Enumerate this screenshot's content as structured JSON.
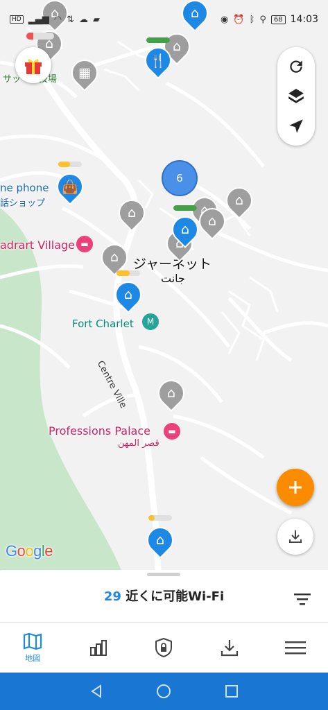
{
  "status_bar": {
    "time": "14:03",
    "battery": "68",
    "hd_badge": "HD",
    "left_icons": [
      "hd-icon",
      "signal-icon",
      "wifi-icon",
      "data-arrows-icon",
      "cloud-icon",
      "app-icon"
    ],
    "right_icons": [
      "eye-icon",
      "alarm-icon",
      "bluetooth-icon",
      "location-icon",
      "battery-icon"
    ]
  },
  "map": {
    "labels": {
      "sports_field": "サッ　球技場",
      "phone_shop_en": "ne phone",
      "phone_shop_ja": "話ショップ",
      "village": "adrart Village",
      "city_ja": "ジャーネット",
      "city_ar": "جانت",
      "fort": "Fort Charlet",
      "road": "Centre Ville",
      "palace_en": "Professions Palace",
      "palace_ar": "قصر المهن"
    },
    "cluster_count": "6",
    "google_letters": [
      "G",
      "o",
      "o",
      "g",
      "l",
      "e"
    ]
  },
  "colors": {
    "accent": "#1e88e5",
    "orange": "#fb8c00",
    "nav_bar": "#1976d2",
    "pin_gray": "#9e9e9e",
    "speed_green": "#43a047",
    "speed_yellow": "#fbc02d",
    "speed_red": "#ef5350"
  },
  "bottom_sheet": {
    "count": "29",
    "nearby_text": "近くに可能Wi-Fi"
  },
  "bottom_nav": {
    "items": [
      {
        "label": "地図",
        "icon": "map-icon",
        "active": true
      },
      {
        "label": "",
        "icon": "chart-icon",
        "active": false
      },
      {
        "label": "",
        "icon": "shield-lock-icon",
        "active": false
      },
      {
        "label": "",
        "icon": "download-icon",
        "active": false
      },
      {
        "label": "",
        "icon": "menu-icon",
        "active": false
      }
    ]
  }
}
